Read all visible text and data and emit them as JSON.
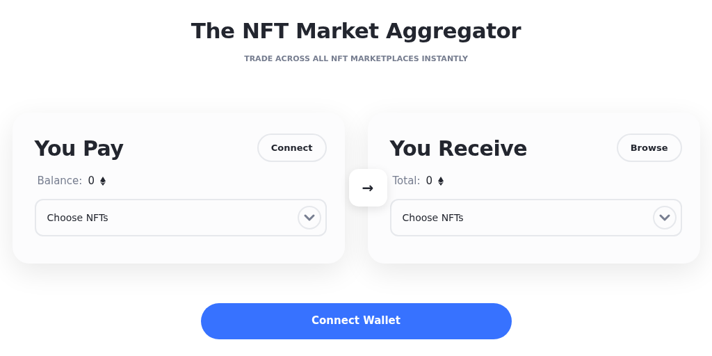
{
  "header": {
    "title": "The NFT Market Aggregator",
    "subtitle": "TRADE ACROSS ALL NFT MARKETPLACES INSTANTLY"
  },
  "panels": [
    {
      "title": "You Pay",
      "button": "Connect",
      "amount_label": "Balance:",
      "amount": "0",
      "select": {
        "placeholder": "Choose NFTs"
      }
    },
    {
      "title": "You Receive",
      "button": "Browse",
      "amount_label": "Total:",
      "amount": "0",
      "select": {
        "placeholder": "Choose NFTs"
      }
    }
  ],
  "swap_button": "→",
  "primary_button": "Connect Wallet"
}
